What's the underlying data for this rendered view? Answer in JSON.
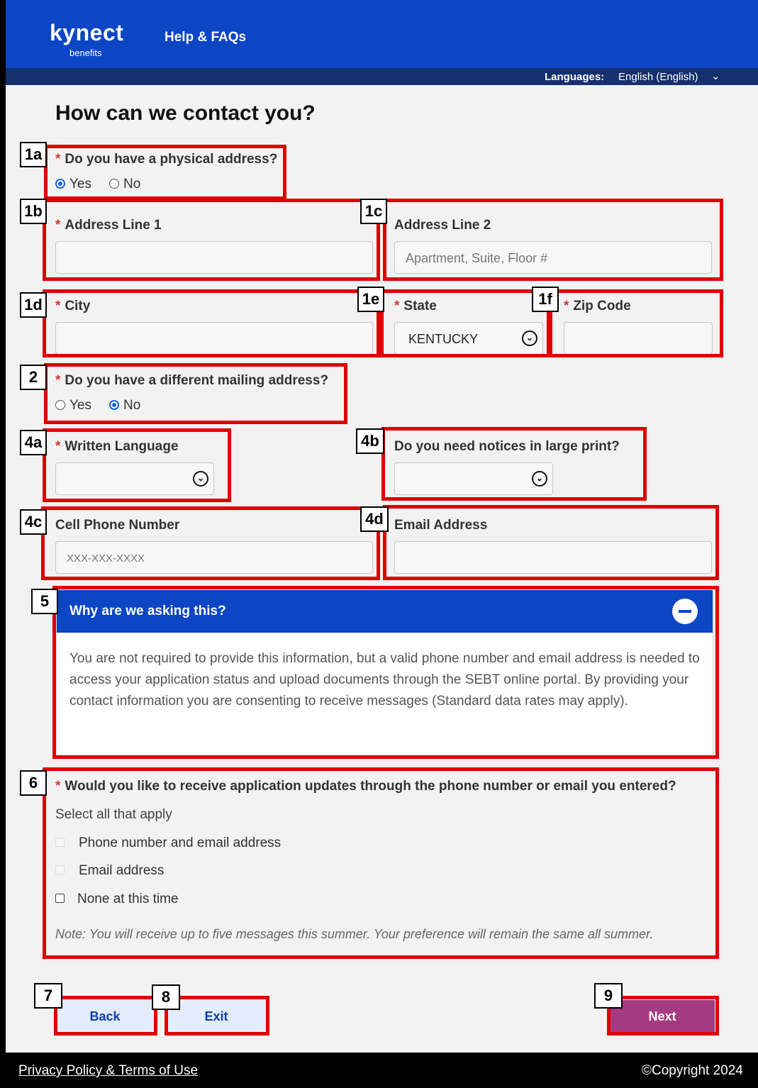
{
  "header": {
    "logo_main": "kynect",
    "logo_sub": "benefits",
    "help_link": "Help & FAQs",
    "languages_label": "Languages:",
    "language_value": "English (English)"
  },
  "page": {
    "title": "How can we contact you?"
  },
  "physical_address": {
    "question": "Do you have a physical address?",
    "options": [
      "Yes",
      "No"
    ],
    "selected": "Yes"
  },
  "address": {
    "line1_label": "Address Line 1",
    "line1_value": "",
    "line2_label": "Address Line 2",
    "line2_placeholder": "Apartment, Suite, Floor #",
    "city_label": "City",
    "city_value": "",
    "state_label": "State",
    "state_value": "KENTUCKY",
    "zip_label": "Zip Code",
    "zip_value": ""
  },
  "mailing_address": {
    "question": "Do you have a different mailing address?",
    "options": [
      "Yes",
      "No"
    ],
    "selected": "No"
  },
  "language": {
    "written_label": "Written Language",
    "written_value": "",
    "large_print_label": "Do you need notices in large print?",
    "large_print_value": ""
  },
  "contact": {
    "phone_label": "Cell Phone Number",
    "phone_placeholder": "XXX-XXX-XXXX",
    "email_label": "Email Address",
    "email_value": ""
  },
  "why_panel": {
    "title": "Why are we asking this?",
    "body": "You are not required to provide this information, but a valid phone number and email address is needed to access your application status and upload documents through the SEBT online portal. By providing your contact information you are consenting to receive messages (Standard data rates may apply)."
  },
  "updates": {
    "question": "Would you like to receive application updates through the phone number or email you entered?",
    "hint": "Select all that apply",
    "options": [
      "Phone number and email address",
      "Email address",
      "None at this time"
    ],
    "note": "Note: You will receive up to five messages this summer. Your preference will remain the same all summer."
  },
  "buttons": {
    "back": "Back",
    "exit": "Exit",
    "next": "Next"
  },
  "footer": {
    "privacy": "Privacy Policy & Terms of Use",
    "copyright": "©Copyright 2024"
  },
  "callouts": [
    "1a",
    "1b",
    "1c",
    "1d",
    "1e",
    "1f",
    "2",
    "4a",
    "4b",
    "4c",
    "4d",
    "5",
    "6",
    "7",
    "8",
    "9"
  ],
  "colors": {
    "header_blue": "#0c46c4",
    "annotation_red": "#e00000",
    "next_button": "#a43a82",
    "required_star": "#d23a2f"
  }
}
